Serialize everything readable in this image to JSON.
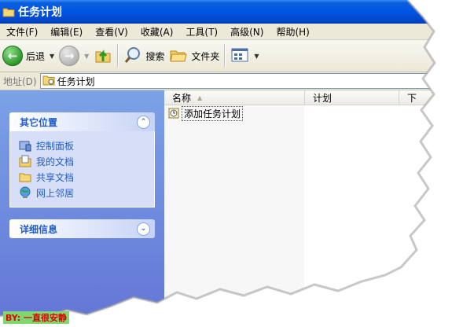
{
  "window": {
    "title": "任务计划"
  },
  "menu": [
    "文件(F)",
    "编辑(E)",
    "查看(V)",
    "收藏(A)",
    "工具(T)",
    "高级(N)",
    "帮助(H)"
  ],
  "toolbar": {
    "back_label": "后退",
    "search_label": "搜索",
    "folders_label": "文件夹"
  },
  "address": {
    "label": "地址(D)",
    "value": "任务计划"
  },
  "left_pane": {
    "other_places": {
      "title": "其它位置",
      "items": [
        {
          "label": "控制面板",
          "icon": "control-panel-icon"
        },
        {
          "label": "我的文档",
          "icon": "my-documents-icon"
        },
        {
          "label": "共享文档",
          "icon": "shared-documents-icon"
        },
        {
          "label": "网上邻居",
          "icon": "network-places-icon"
        }
      ]
    },
    "details": {
      "title": "详细信息"
    }
  },
  "list": {
    "columns": [
      "名称",
      "计划",
      "下"
    ],
    "rows": [
      {
        "name": "添加任务计划",
        "icon": "add-task-icon"
      }
    ]
  },
  "watermark": "BY: 一直很安静",
  "colors": {
    "titlebar": "#0054e3",
    "taskpane": "#6f8fe0",
    "link": "#215dc6"
  }
}
